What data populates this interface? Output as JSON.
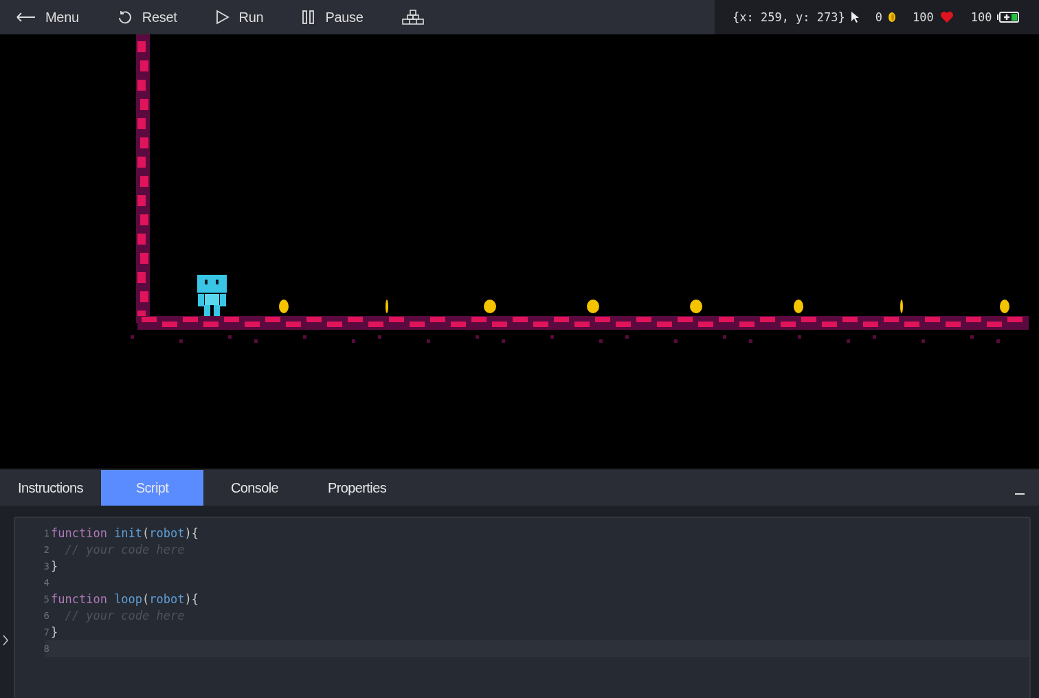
{
  "toolbar": [
    {
      "kind": "back",
      "label": "Menu"
    },
    {
      "kind": "reset",
      "label": "Reset"
    },
    {
      "kind": "run",
      "label": "Run"
    },
    {
      "kind": "pause",
      "label": "Pause"
    },
    {
      "kind": "blocks"
    }
  ],
  "status": {
    "cursor": "{x: 259, y: 273}",
    "coins": "0",
    "health": "100",
    "energy": "100"
  },
  "tabs": [
    {
      "label": "Instructions",
      "selected": false
    },
    {
      "label": "Script",
      "selected": true
    },
    {
      "label": "Console",
      "selected": false
    },
    {
      "label": "Properties",
      "selected": false
    }
  ],
  "editor": {
    "lines": [
      {
        "number": "1",
        "active": false,
        "tokens": [
          {
            "kind": "keyword",
            "text": "function "
          },
          {
            "kind": "name",
            "text": "init"
          },
          {
            "kind": "punct",
            "text": "("
          },
          {
            "kind": "name",
            "text": "robot"
          },
          {
            "kind": "punct",
            "text": "){"
          }
        ]
      },
      {
        "number": "2",
        "active": false,
        "tokens": [
          {
            "kind": "comment",
            "text": "  // your code here"
          }
        ]
      },
      {
        "number": "3",
        "active": false,
        "tokens": [
          {
            "kind": "punct",
            "text": "}"
          }
        ]
      },
      {
        "number": "4",
        "active": false
      },
      {
        "number": "5",
        "active": false,
        "tokens": [
          {
            "kind": "keyword",
            "text": "function "
          },
          {
            "kind": "name",
            "text": "loop"
          },
          {
            "kind": "punct",
            "text": "("
          },
          {
            "kind": "name",
            "text": "robot"
          },
          {
            "kind": "punct",
            "text": "){"
          }
        ]
      },
      {
        "number": "6",
        "active": false,
        "tokens": [
          {
            "kind": "comment",
            "text": "  // your code here"
          }
        ]
      },
      {
        "number": "7",
        "active": false,
        "tokens": [
          {
            "kind": "punct",
            "text": "}"
          }
        ]
      },
      {
        "number": "8",
        "active": true
      }
    ]
  }
}
